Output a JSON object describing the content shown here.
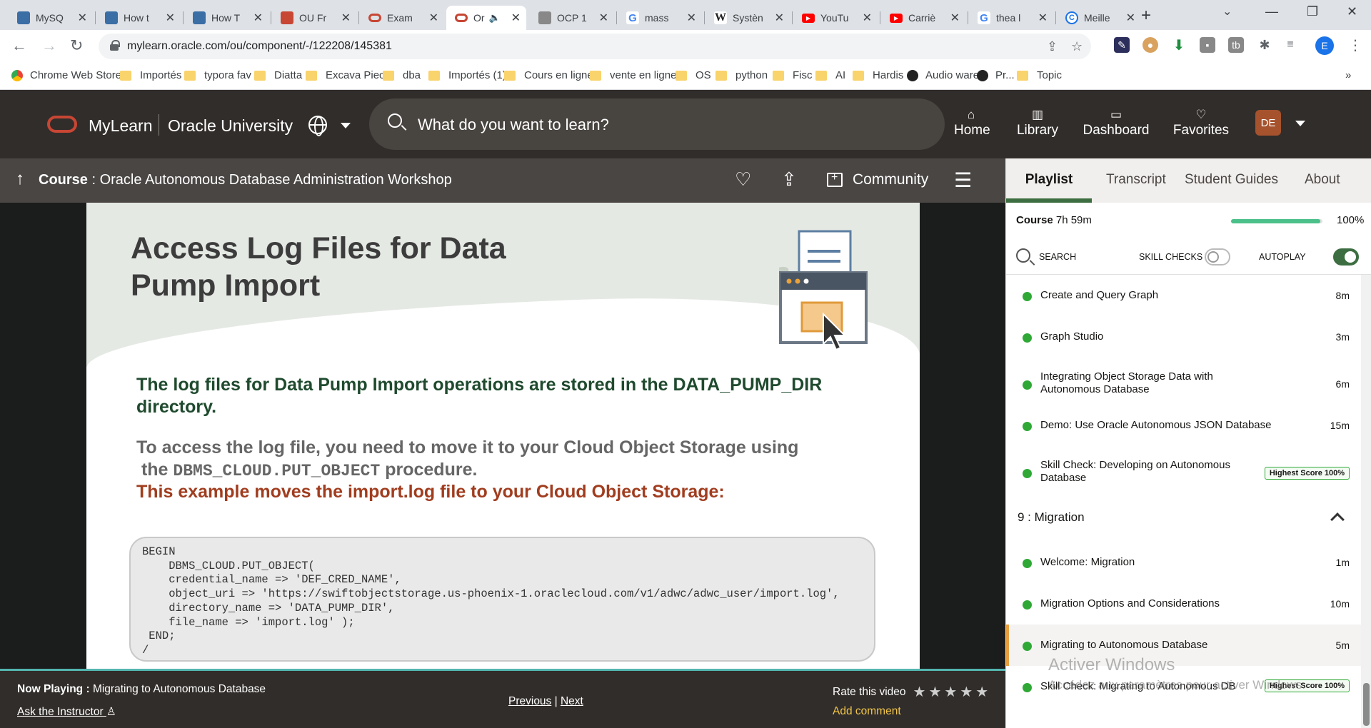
{
  "browser": {
    "tabs": [
      {
        "title": "MySQ",
        "favicon_color": "#3a6ea5"
      },
      {
        "title": "How t",
        "favicon_color": "#3a6ea5"
      },
      {
        "title": "How T",
        "favicon_color": "#3a6ea5"
      },
      {
        "title": "OU Fr",
        "favicon_color": "#c74634"
      },
      {
        "title": "Exam",
        "favicon_color": "#c74634"
      },
      {
        "title": "Or",
        "favicon_color": "#c74634",
        "active": true
      },
      {
        "title": "OCP 1",
        "favicon_color": "#888888"
      },
      {
        "title": "mass",
        "favicon_color": "#4285f4"
      },
      {
        "title": "Systèn",
        "favicon_color": "#222222"
      },
      {
        "title": "YouTu",
        "favicon_color": "#ff0000"
      },
      {
        "title": "Carriè",
        "favicon_color": "#ff0000"
      },
      {
        "title": "thea l",
        "favicon_color": "#4285f4"
      },
      {
        "title": "Meille",
        "favicon_color": "#1a73e8"
      }
    ],
    "url": "mylearn.oracle.com/ou/component/-/122208/145381",
    "profile_initial": "E",
    "bookmarks": [
      {
        "label": "Chrome Web Store...",
        "type": "app"
      },
      {
        "label": "Importés",
        "type": "folder"
      },
      {
        "label": "typora fav",
        "type": "folder"
      },
      {
        "label": "Diatta",
        "type": "folder"
      },
      {
        "label": "Excava Piece",
        "type": "folder"
      },
      {
        "label": "dba",
        "type": "folder"
      },
      {
        "label": "Importés (1)",
        "type": "folder"
      },
      {
        "label": "Cours en ligne",
        "type": "folder"
      },
      {
        "label": "vente en ligne",
        "type": "folder"
      },
      {
        "label": "OS",
        "type": "folder"
      },
      {
        "label": "python",
        "type": "folder"
      },
      {
        "label": "Fisc",
        "type": "folder"
      },
      {
        "label": "AI",
        "type": "folder"
      },
      {
        "label": "Hardis",
        "type": "folder"
      },
      {
        "label": "Audio wareZ",
        "type": "site"
      },
      {
        "label": "Pr...",
        "type": "site"
      },
      {
        "label": "Topic",
        "type": "folder"
      }
    ]
  },
  "header": {
    "brand": "MyLearn",
    "org": "Oracle University",
    "search_placeholder": "What do you want to learn?",
    "nav": [
      {
        "label": "Home",
        "icon": "home-icon"
      },
      {
        "label": "Library",
        "icon": "library-icon"
      },
      {
        "label": "Dashboard",
        "icon": "dashboard-icon"
      },
      {
        "label": "Favorites",
        "icon": "heart-icon"
      }
    ],
    "avatar_initials": "DE"
  },
  "coursebar": {
    "prefix": "Course",
    "title": ": Oracle Autonomous Database Administration Workshop",
    "community": "Community"
  },
  "slide": {
    "title": "Access Log Files for Data Pump Import",
    "p1": "The log files for Data Pump Import operations are stored in the DATA_PUMP_DIR directory.",
    "p2_a": "To access the log file, you need to move it to your Cloud Object Storage using",
    "p2_code": "DBMS_CLOUD.PUT_OBJECT",
    "p2_b": "procedure.",
    "p2_the": "the",
    "p3": "This example moves the import.log file to your Cloud Object Storage:",
    "code": "BEGIN\n    DBMS_CLOUD.PUT_OBJECT(\n    credential_name => 'DEF_CRED_NAME',\n    object_uri => 'https://swiftobjectstorage.us-phoenix-1.oraclecloud.com/v1/adwc/adwc_user/import.log',\n    directory_name => 'DATA_PUMP_DIR',\n    file_name => 'import.log' );\n END;\n/"
  },
  "player": {
    "now_playing_label": "Now Playing :",
    "now_playing": "Migrating to Autonomous Database",
    "ask": "Ask the Instructor",
    "previous": "Previous",
    "separator": "|",
    "next": "Next",
    "rate": "Rate this video",
    "add_comment": "Add comment",
    "progress_fraction": 1.0
  },
  "panel": {
    "tabs": [
      "Playlist",
      "Transcript",
      "Student Guides",
      "About"
    ],
    "course_label": "Course",
    "course_duration": "7h 59m",
    "course_pct": "100%",
    "course_progress": 0.98,
    "search": "SEARCH",
    "skill_checks": "SKILL CHECKS",
    "autoplay": "AUTOPLAY",
    "items": [
      {
        "title": "Create and Query Graph",
        "duration": "8m"
      },
      {
        "title": "Graph Studio",
        "duration": "3m"
      },
      {
        "title": "Integrating Object Storage Data with Autonomous Database",
        "duration": "6m"
      },
      {
        "title": "Demo: Use Oracle Autonomous JSON Database",
        "duration": "15m"
      },
      {
        "title": "Skill Check: Developing on Autonomous Database",
        "badge": "Highest Score 100%"
      }
    ],
    "section": "9 :  Migration",
    "section_items": [
      {
        "title": "Welcome: Migration",
        "duration": "1m"
      },
      {
        "title": "Migration Options and Considerations",
        "duration": "10m"
      },
      {
        "title": "Migrating to Autonomous Database",
        "duration": "5m"
      },
      {
        "title": "Skill Check: Migrating to Autonomous DB",
        "badge": "Highest Score 100%"
      }
    ]
  },
  "watermark": {
    "line1": "Activer Windows",
    "line2": "Accédez aux paramètres pour activer Windows."
  }
}
